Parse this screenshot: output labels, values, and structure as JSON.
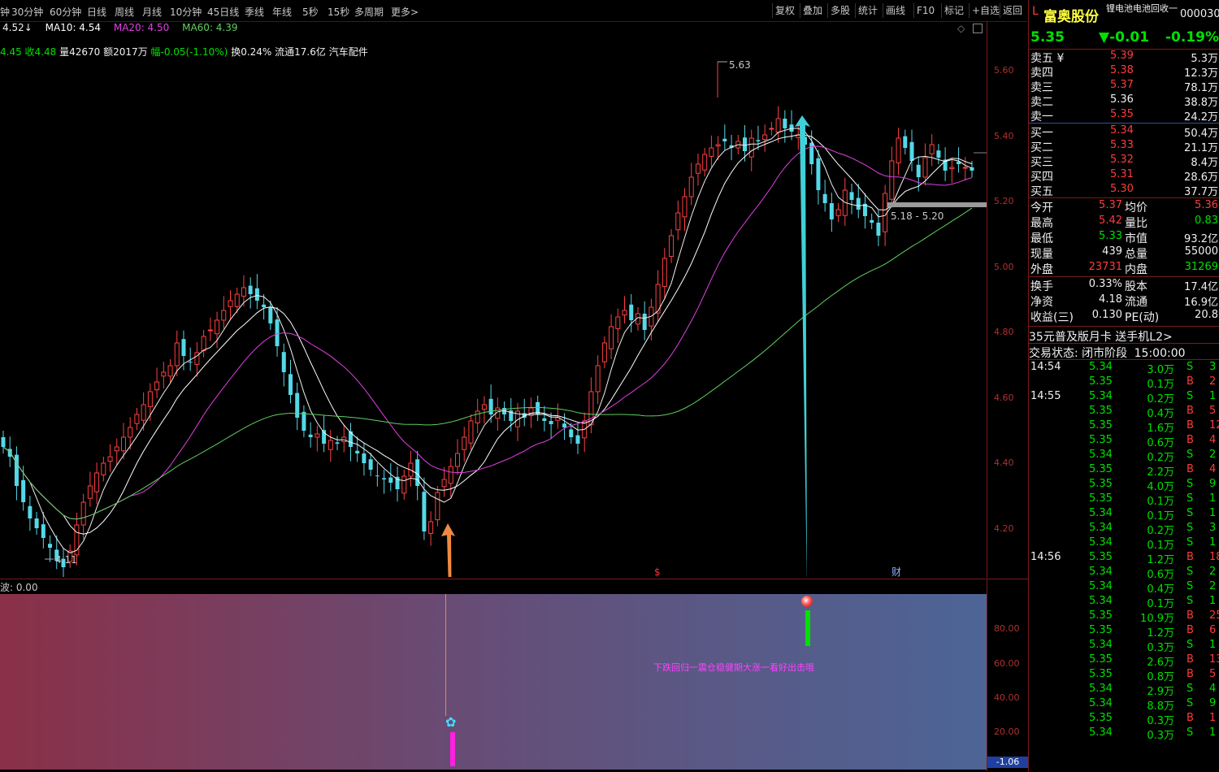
{
  "topbar": {
    "periods": [
      "钟",
      "30分钟",
      "60分钟",
      "日线",
      "周线",
      "月线",
      "10分钟",
      "45日线",
      "季线",
      "年线",
      "5秒",
      "15秒",
      "多周期",
      "更多>"
    ],
    "tools": [
      "复权",
      "叠加",
      "多股",
      "统计",
      "画线",
      "F10",
      "标记",
      "+自选",
      "返回"
    ]
  },
  "ma_legend": {
    "ma5": "4.52↓",
    "ma10": "MA10: 4.54",
    "ma20": "MA20: 4.50",
    "ma60": "MA60: 4.39",
    "colors": {
      "ma5": "#f0f0f0",
      "ma10": "#ffffff",
      "ma20": "#e040e0",
      "ma60": "#60d060"
    }
  },
  "info_line": {
    "open_close": "4.45 收4.48",
    "volume": "量42670",
    "amount": "额2017万",
    "change": "幅-0.05(-1.10%)",
    "turnover": "换0.24%",
    "float": "流通17.6亿",
    "sector": "汽车配件"
  },
  "price_axis": {
    "ticks": [
      "5.60",
      "5.40",
      "5.20",
      "5.00",
      "4.80",
      "4.60",
      "4.40",
      "4.20"
    ]
  },
  "chart_annotations": {
    "high_label": "5.63",
    "low_label": "4.11",
    "range_label": "5.18 - 5.20",
    "marker_dollar": "$",
    "marker_cai": "财"
  },
  "indicator": {
    "header": "波: 0.00",
    "ticks": [
      "80.00",
      "60.00",
      "40.00",
      "20.00"
    ],
    "bottom_value": "-1.06",
    "signal_text": "下跌回归一震仓稳健期大涨一看好出击哦"
  },
  "stock": {
    "prefix": "L",
    "name": "富奥股份",
    "code": "000030",
    "sector_tag": "锂电池电池回收一",
    "price": "5.35",
    "change": "▼-0.01",
    "change_pct": "-0.19%"
  },
  "order_book": {
    "asks": [
      {
        "label": "卖五 ¥",
        "price": "5.39",
        "vol": "5.3万"
      },
      {
        "label": "卖四",
        "price": "5.38",
        "vol": "12.3万"
      },
      {
        "label": "卖三",
        "price": "5.37",
        "vol": "78.1万"
      },
      {
        "label": "卖二",
        "price": "5.36",
        "vol": "38.8万"
      },
      {
        "label": "卖一",
        "price": "5.35",
        "vol": "24.2万"
      }
    ],
    "bids": [
      {
        "label": "买一",
        "price": "5.34",
        "vol": "50.4万"
      },
      {
        "label": "买二",
        "price": "5.33",
        "vol": "21.1万"
      },
      {
        "label": "买三",
        "price": "5.32",
        "vol": "8.4万"
      },
      {
        "label": "买四",
        "price": "5.31",
        "vol": "28.6万"
      },
      {
        "label": "买五",
        "price": "5.30",
        "vol": "37.7万"
      }
    ]
  },
  "stats": [
    {
      "l1": "今开",
      "v1": "5.37",
      "l2": "均价",
      "v2": "5.36"
    },
    {
      "l1": "最高",
      "v1": "5.42",
      "l2": "量比",
      "v2": "0.83"
    },
    {
      "l1": "最低",
      "v1": "5.33",
      "l2": "市值",
      "v2": "93.2亿"
    },
    {
      "l1": "现量",
      "v1": "439",
      "l2": "总量",
      "v2": "55000"
    },
    {
      "l1": "外盘",
      "v1": "23731",
      "l2": "内盘",
      "v2": "31269"
    },
    {
      "l1": "换手",
      "v1": "0.33%",
      "l2": "股本",
      "v2": "17.4亿"
    },
    {
      "l1": "净资",
      "v1": "4.18",
      "l2": "流通",
      "v2": "16.9亿"
    },
    {
      "l1": "收益(三)",
      "v1": "0.130",
      "l2": "PE(动)",
      "v2": "20.8"
    }
  ],
  "promo": "35元普及版月卡 送手机L2>",
  "trade_status": {
    "label": "交易状态: 闭市阶段",
    "time": "15:00:00"
  },
  "ticks": [
    {
      "time": "14:54",
      "price": "5.34",
      "vol": "3.0万",
      "side": "S",
      "n": "3"
    },
    {
      "time": "",
      "price": "5.35",
      "vol": "0.1万",
      "side": "B",
      "n": "2"
    },
    {
      "time": "14:55",
      "price": "5.34",
      "vol": "0.2万",
      "side": "S",
      "n": "1"
    },
    {
      "time": "",
      "price": "5.35",
      "vol": "0.4万",
      "side": "B",
      "n": "5"
    },
    {
      "time": "",
      "price": "5.35",
      "vol": "1.6万",
      "side": "B",
      "n": "12"
    },
    {
      "time": "",
      "price": "5.35",
      "vol": "0.6万",
      "side": "B",
      "n": "4"
    },
    {
      "time": "",
      "price": "5.34",
      "vol": "0.2万",
      "side": "S",
      "n": "2"
    },
    {
      "time": "",
      "price": "5.35",
      "vol": "2.2万",
      "side": "B",
      "n": "4"
    },
    {
      "time": "",
      "price": "5.35",
      "vol": "4.0万",
      "side": "S",
      "n": "9"
    },
    {
      "time": "",
      "price": "5.35",
      "vol": "0.1万",
      "side": "S",
      "n": "1"
    },
    {
      "time": "",
      "price": "5.34",
      "vol": "0.1万",
      "side": "S",
      "n": "1"
    },
    {
      "time": "",
      "price": "5.34",
      "vol": "0.2万",
      "side": "S",
      "n": "3"
    },
    {
      "time": "",
      "price": "5.34",
      "vol": "0.1万",
      "side": "S",
      "n": "1"
    },
    {
      "time": "14:56",
      "price": "5.35",
      "vol": "1.2万",
      "side": "B",
      "n": "18"
    },
    {
      "time": "",
      "price": "5.34",
      "vol": "0.6万",
      "side": "S",
      "n": "2"
    },
    {
      "time": "",
      "price": "5.34",
      "vol": "0.4万",
      "side": "S",
      "n": "2"
    },
    {
      "time": "",
      "price": "5.34",
      "vol": "0.1万",
      "side": "S",
      "n": "1"
    },
    {
      "time": "",
      "price": "5.35",
      "vol": "10.9万",
      "side": "B",
      "n": "25"
    },
    {
      "time": "",
      "price": "5.35",
      "vol": "1.2万",
      "side": "B",
      "n": "6"
    },
    {
      "time": "",
      "price": "5.34",
      "vol": "0.3万",
      "side": "S",
      "n": "1"
    },
    {
      "time": "",
      "price": "5.35",
      "vol": "2.6万",
      "side": "B",
      "n": "13"
    },
    {
      "time": "",
      "price": "5.35",
      "vol": "0.8万",
      "side": "B",
      "n": "5"
    },
    {
      "time": "",
      "price": "5.34",
      "vol": "2.9万",
      "side": "S",
      "n": "4"
    },
    {
      "time": "",
      "price": "5.34",
      "vol": "8.8万",
      "side": "S",
      "n": "9"
    },
    {
      "time": "",
      "price": "5.35",
      "vol": "0.3万",
      "side": "B",
      "n": "1"
    },
    {
      "time": "",
      "price": "5.34",
      "vol": "0.3万",
      "side": "S",
      "n": "1"
    }
  ],
  "chart_data": {
    "type": "candlestick",
    "y_range": [
      4.1,
      5.7
    ],
    "up_color": "#ff4040",
    "down_color": "#54d8e8",
    "closes": [
      4.5,
      4.47,
      4.38,
      4.33,
      4.28,
      4.25,
      4.22,
      4.19,
      4.15,
      4.13,
      4.18,
      4.26,
      4.33,
      4.38,
      4.42,
      4.45,
      4.47,
      4.5,
      4.53,
      4.56,
      4.6,
      4.63,
      4.67,
      4.7,
      4.73,
      4.75,
      4.82,
      4.78,
      4.76,
      4.79,
      4.84,
      4.86,
      4.89,
      4.92,
      4.95,
      4.97,
      4.99,
      4.97,
      4.95,
      4.93,
      4.88,
      4.81,
      4.73,
      4.66,
      4.59,
      4.55,
      4.53,
      4.54,
      4.51,
      4.52,
      4.51,
      4.53,
      4.5,
      4.48,
      4.45,
      4.43,
      4.41,
      4.4,
      4.39,
      4.37,
      4.41,
      4.45,
      4.38,
      4.24,
      4.27,
      4.36,
      4.4,
      4.44,
      4.48,
      4.53,
      4.58,
      4.61,
      4.63,
      4.6,
      4.62,
      4.6,
      4.58,
      4.61,
      4.59,
      4.62,
      4.6,
      4.58,
      4.57,
      4.59,
      4.56,
      4.53,
      4.51,
      4.58,
      4.67,
      4.75,
      4.82,
      4.87,
      4.9,
      4.92,
      4.89,
      4.91,
      4.86,
      4.93,
      5.0,
      5.08,
      5.15,
      5.22,
      5.27,
      5.33,
      5.37,
      5.4,
      5.42,
      5.43,
      5.44,
      5.42,
      5.44,
      5.41,
      5.45,
      5.44,
      5.46,
      5.48,
      5.51,
      5.48,
      5.47,
      5.46,
      5.43,
      5.37,
      5.29,
      5.25,
      5.2,
      5.23,
      5.29,
      5.26,
      5.23,
      5.21,
      5.19,
      5.15,
      5.28,
      5.38,
      5.45,
      5.42,
      5.38,
      5.33,
      5.39,
      5.43,
      5.39,
      5.35,
      5.36,
      5.37,
      5.36,
      5.35
    ]
  }
}
